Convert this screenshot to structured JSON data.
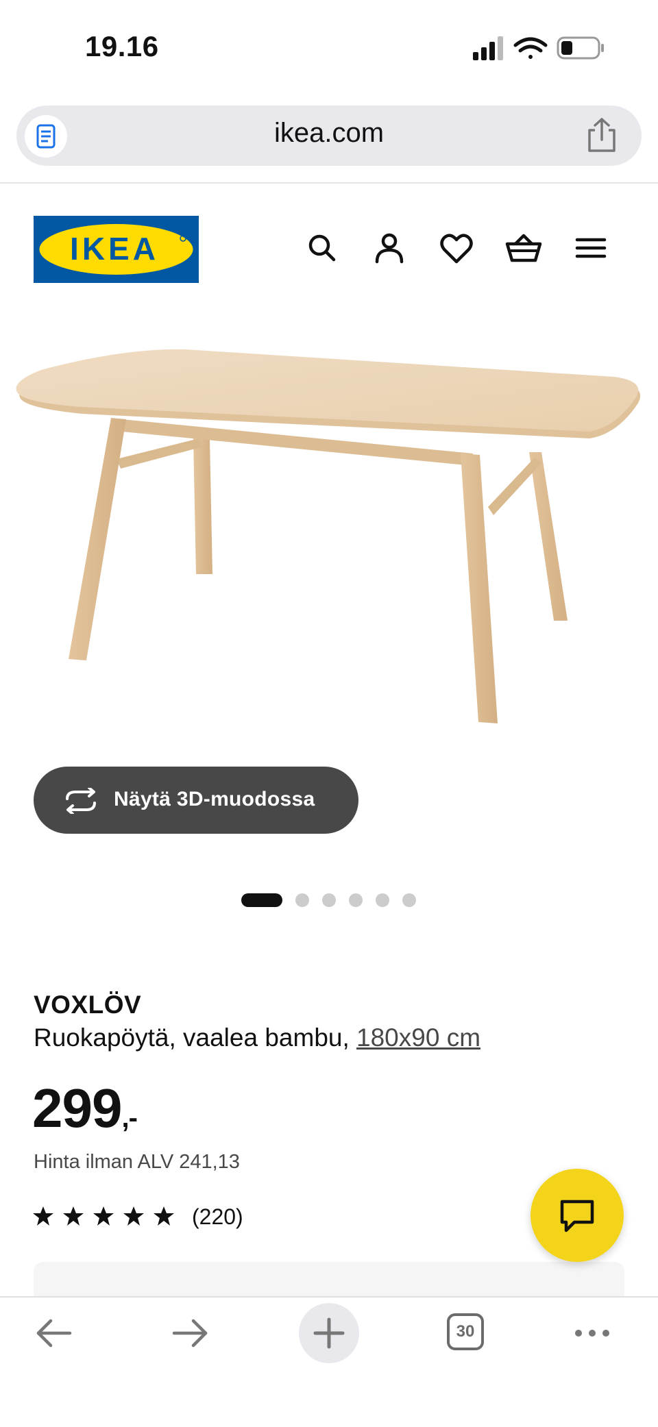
{
  "status_bar": {
    "time": "19.16",
    "icons": [
      "signal-icon",
      "wifi-icon",
      "battery-icon"
    ]
  },
  "browser": {
    "url": "ikea.com",
    "tabs_count": "30"
  },
  "site": {
    "logo_text": "IKEA",
    "header_icons": [
      "search-icon",
      "account-icon",
      "favorites-icon",
      "cart-icon",
      "menu-icon"
    ]
  },
  "product": {
    "view_3d_label": "Näytä 3D-muodossa",
    "carousel": {
      "count": 6,
      "active_index": 0
    },
    "name": "VOXLÖV",
    "description": "Ruokapöytä, vaalea bambu,",
    "size": "180x90 cm",
    "price": "299",
    "price_suffix": ",-",
    "price_vat": "Hinta ilman ALV 241,13",
    "rating": 5,
    "rating_max": 5,
    "review_count": "(220)"
  },
  "colors": {
    "ikea_blue": "#0058a3",
    "ikea_yellow": "#ffdb00",
    "chat_yellow": "#f4d41a",
    "button_dark": "#484848"
  }
}
